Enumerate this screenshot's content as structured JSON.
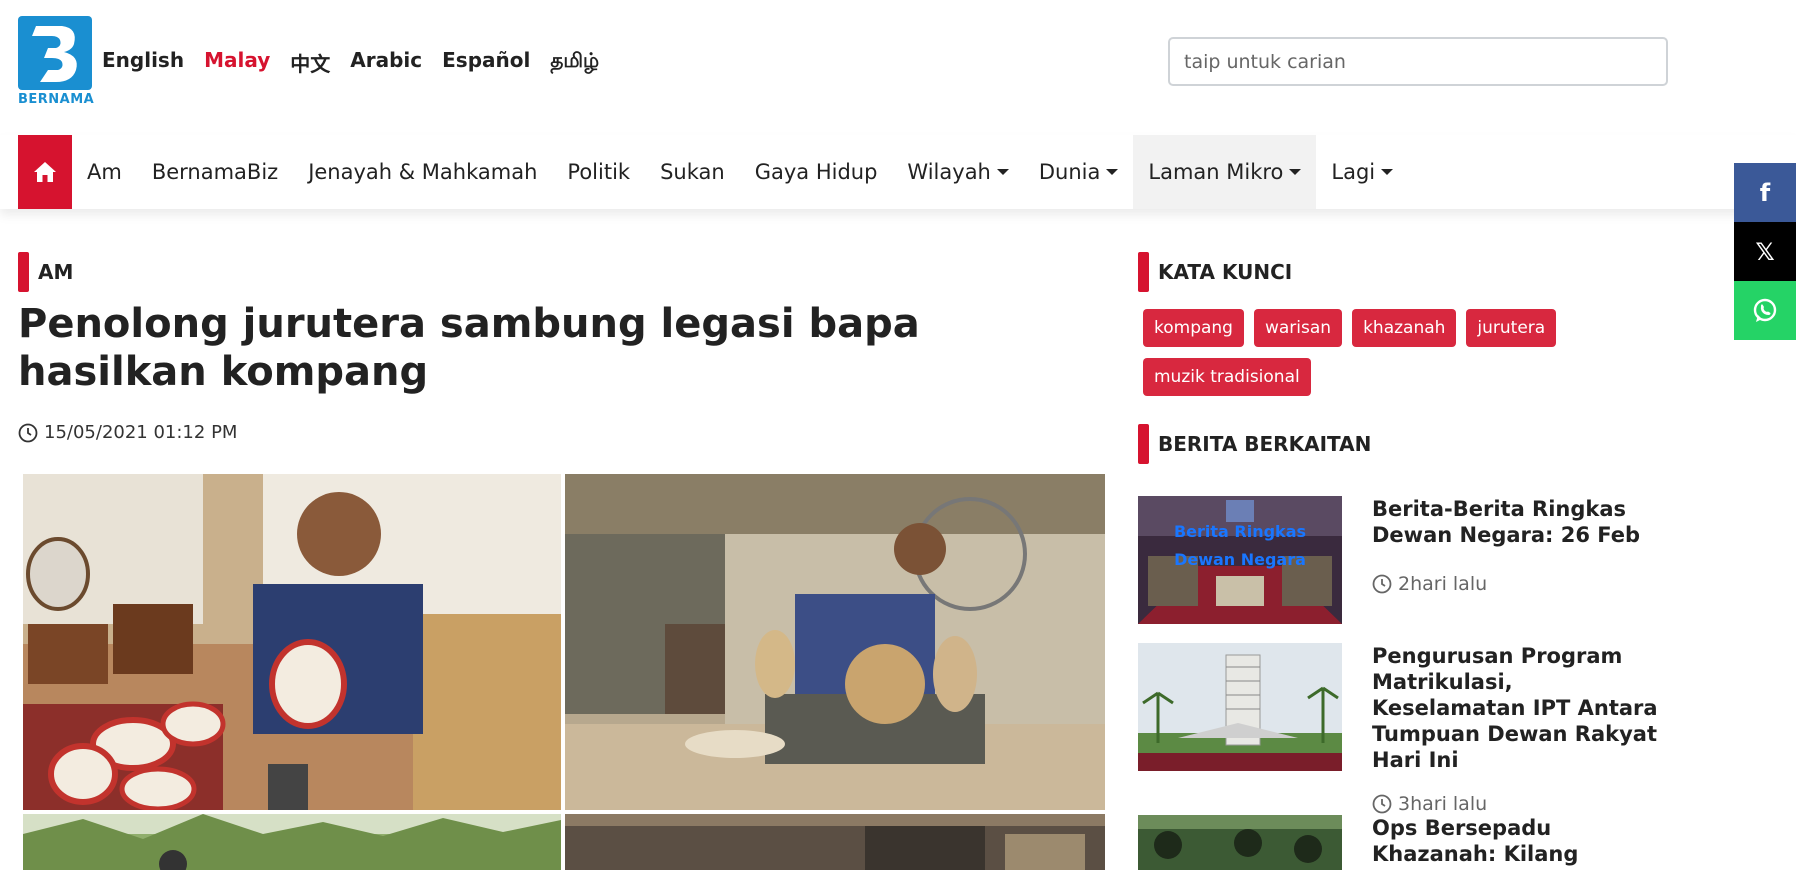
{
  "logo": {
    "text": "BERNAMA"
  },
  "languages": [
    "English",
    "Malay",
    "中文",
    "Arabic",
    "Español",
    "தமிழ்"
  ],
  "active_language": "Malay",
  "search": {
    "placeholder": "taip untuk carian"
  },
  "nav": {
    "home_icon": "home-icon",
    "items": [
      {
        "label": "Am",
        "dropdown": false
      },
      {
        "label": "BernamaBiz",
        "dropdown": false
      },
      {
        "label": "Jenayah & Mahkamah",
        "dropdown": false
      },
      {
        "label": "Politik",
        "dropdown": false
      },
      {
        "label": "Sukan",
        "dropdown": false
      },
      {
        "label": "Gaya Hidup",
        "dropdown": false
      },
      {
        "label": "Wilayah",
        "dropdown": true
      },
      {
        "label": "Dunia",
        "dropdown": true
      },
      {
        "label": "Laman Mikro",
        "dropdown": true
      },
      {
        "label": "Lagi",
        "dropdown": true
      }
    ]
  },
  "social": [
    {
      "name": "facebook",
      "glyph": "f",
      "color": "#3b5998"
    },
    {
      "name": "x",
      "glyph": "𝕏",
      "color": "#000000"
    },
    {
      "name": "whatsapp",
      "glyph": "✆",
      "color": "#25d366"
    }
  ],
  "article": {
    "category": "AM",
    "title": "Penolong jurutera sambung legasi bapa hasilkan kompang",
    "date": "15/05/2021 01:12 PM"
  },
  "sidebar": {
    "keywords_title": "KATA KUNCI",
    "tags": [
      "kompang",
      "warisan",
      "khazanah",
      "jurutera",
      "muzik tradisional"
    ],
    "related_title": "BERITA BERKAITAN",
    "related": [
      {
        "title": "Berita-Berita Ringkas Dewan Negara: 26 Feb",
        "time": "2hari lalu",
        "thumb_caption_1": "Berita Ringkas",
        "thumb_caption_2": "Dewan Negara"
      },
      {
        "title": "Pengurusan Program Matrikulasi, Keselamatan IPT Antara Tumpuan Dewan Rakyat Hari Ini",
        "time": "3hari lalu"
      },
      {
        "title": "Ops Bersepadu Khazanah: Kilang Perabot Tanpa",
        "time": ""
      }
    ]
  },
  "colors": {
    "accent": "#d6132f",
    "brand": "#1a8fd1"
  }
}
